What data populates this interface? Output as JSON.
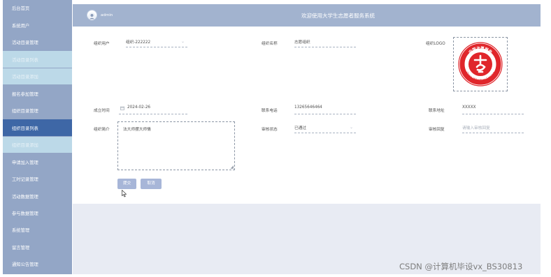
{
  "sidebar": {
    "items": [
      {
        "label": "后台首页"
      },
      {
        "label": "系统用户"
      },
      {
        "label": "活动目录管理"
      },
      {
        "label": "活动目录列表"
      },
      {
        "label": "活动目录添加"
      },
      {
        "label": "报名参加管理"
      },
      {
        "label": "组织目录管理"
      },
      {
        "label": "组织目录列表"
      },
      {
        "label": "组织目录添加"
      },
      {
        "label": "申请加入管理"
      },
      {
        "label": "工时记录管理"
      },
      {
        "label": "活动数据管理"
      },
      {
        "label": "参与数据管理"
      },
      {
        "label": "系统管理"
      },
      {
        "label": "留言管理"
      },
      {
        "label": "通知公告管理"
      }
    ]
  },
  "header": {
    "user": "admin",
    "title": "欢迎使用大学生志愿者服务系统"
  },
  "form": {
    "org_user": {
      "label": "组织用户",
      "value": "组织-222222"
    },
    "org_name": {
      "label": "组织名称",
      "value": "志愿组织"
    },
    "org_logo": {
      "label": "组织LOGO"
    },
    "found_date": {
      "label": "成立时间",
      "value": "2024-02-26"
    },
    "phone": {
      "label": "联系电话",
      "value": "13265646464"
    },
    "address": {
      "label": "联系地址",
      "value": "XXXXX"
    },
    "intro": {
      "label": "组织简介",
      "value": "法大师摆大师情"
    },
    "audit_status": {
      "label": "审核状态",
      "value": "已通过"
    },
    "audit_reply": {
      "label": "审核回复",
      "placeholder": "请输入审核回复"
    }
  },
  "buttons": {
    "submit": "提交",
    "cancel": "取消"
  },
  "logo": {
    "text_top": "中国志愿服务",
    "text_bottom": "China Volunteer Service",
    "color": "#e0262b"
  },
  "watermark": "CSDN @计算机毕设vx_BS30813",
  "colors": {
    "sidebar": "#93a6c6",
    "sidebar_active": "#3e67a6",
    "sidebar_sub": "#bcd9e8",
    "header": "#a2b3cf",
    "button": "#a7b6d8"
  }
}
